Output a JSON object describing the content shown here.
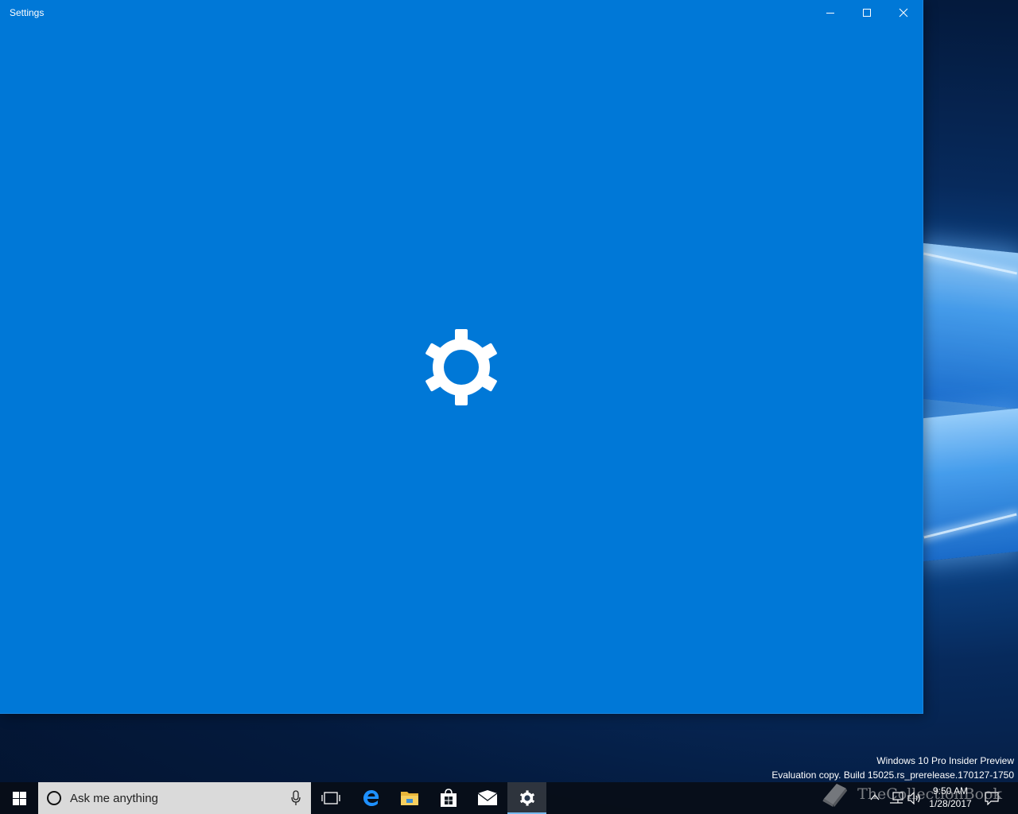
{
  "window": {
    "title": "Settings",
    "background_color": "#0078d7",
    "controls": {
      "minimize_icon": "minimize-icon",
      "maximize_icon": "maximize-icon",
      "close_icon": "close-icon"
    },
    "splash_icon": "gear-icon"
  },
  "watermark": {
    "line1": "Windows 10 Pro Insider Preview",
    "line2": "Evaluation copy. Build 15025.rs_prerelease.170127-1750"
  },
  "taskbar": {
    "start_icon": "windows-logo-icon",
    "search": {
      "placeholder": "Ask me anything",
      "icon": "cortana-circle-icon",
      "mic_icon": "microphone-icon"
    },
    "pinned": [
      {
        "name": "task-view",
        "icon": "task-view-icon"
      },
      {
        "name": "edge",
        "icon": "edge-icon",
        "color": "#1e90ff"
      },
      {
        "name": "file-explorer",
        "icon": "folder-icon",
        "color": "#f2c14e"
      },
      {
        "name": "store",
        "icon": "store-bag-icon"
      },
      {
        "name": "mail",
        "icon": "mail-icon"
      },
      {
        "name": "settings",
        "icon": "gear-icon",
        "active": true
      }
    ],
    "tray": {
      "chevron_icon": "chevron-up-icon",
      "network_icon": "network-icon",
      "volume_icon": "volume-icon",
      "time": "9:50 AM",
      "date": "1/28/2017",
      "action_center_icon": "action-center-icon"
    }
  },
  "overlay_logo": {
    "text": "TheCollectionBook",
    "icon": "book-icon"
  }
}
